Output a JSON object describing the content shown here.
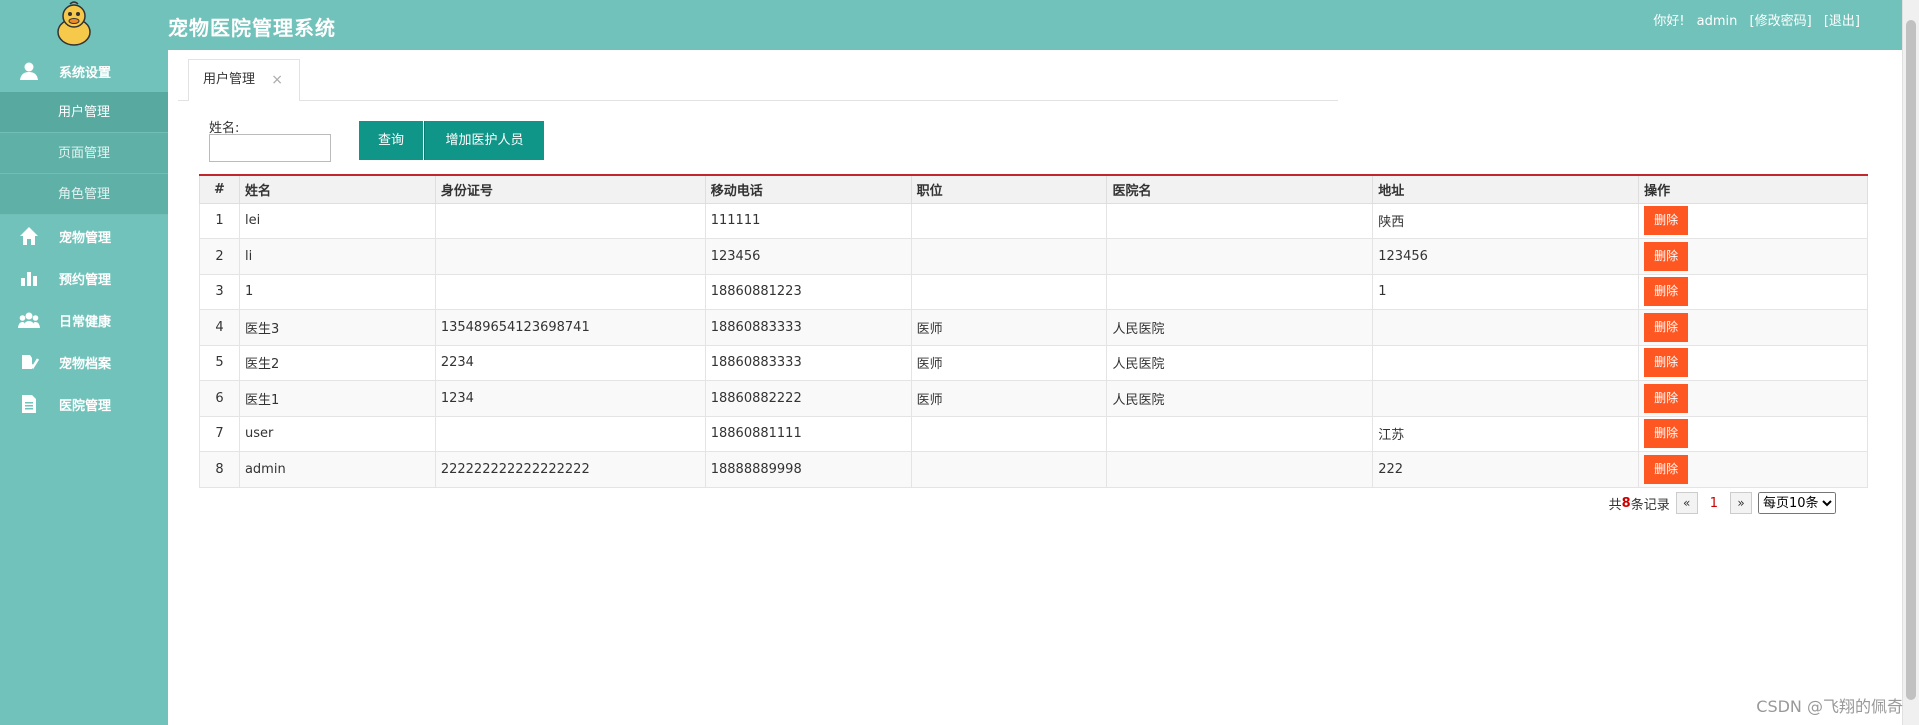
{
  "header": {
    "title": "宠物医院管理系统",
    "greeting": "你好!",
    "username": "admin",
    "change_password": "[修改密码]",
    "logout": "[退出]"
  },
  "sidebar": {
    "items": [
      {
        "label": "系统设置",
        "icon": "user-icon"
      },
      {
        "label": "宠物管理",
        "icon": "home-icon"
      },
      {
        "label": "预约管理",
        "icon": "bar-chart-icon"
      },
      {
        "label": "日常健康",
        "icon": "users-icon"
      },
      {
        "label": "宠物档案",
        "icon": "pet-file-icon"
      },
      {
        "label": "医院管理",
        "icon": "document-icon"
      }
    ],
    "submenu": [
      "用户管理",
      "页面管理",
      "角色管理"
    ]
  },
  "tabs": [
    {
      "label": "用户管理",
      "close": "×"
    }
  ],
  "search": {
    "label": "姓名:",
    "value": "",
    "placeholder": "",
    "query_button": "查询",
    "add_button": "增加医护人员"
  },
  "table": {
    "columns": [
      "#",
      "姓名",
      "身份证号",
      "移动电话",
      "职位",
      "医院名",
      "地址",
      "操作"
    ],
    "rows": [
      [
        "1",
        "lei",
        "",
        "111111",
        "",
        "",
        "陕西"
      ],
      [
        "2",
        "li",
        "",
        "123456",
        "",
        "",
        "123456"
      ],
      [
        "3",
        "1",
        "",
        "18860881223",
        "",
        "",
        "1"
      ],
      [
        "4",
        "医生3",
        "135489654123698741",
        "18860883333",
        "医师",
        "人民医院",
        ""
      ],
      [
        "5",
        "医生2",
        "2234",
        "18860883333",
        "医师",
        "人民医院",
        ""
      ],
      [
        "6",
        "医生1",
        "1234",
        "18860882222",
        "医师",
        "人民医院",
        ""
      ],
      [
        "7",
        "user",
        "",
        "18860881111",
        "",
        "",
        "江苏"
      ],
      [
        "8",
        "admin",
        "222222222222222222",
        "18888889998",
        "",
        "",
        "222"
      ]
    ],
    "delete_label": "删除"
  },
  "pager": {
    "total_prefix": "共",
    "total": "8",
    "total_suffix": "条记录",
    "prev": "«",
    "current": "1",
    "next": "»",
    "page_size": "每页10条"
  },
  "watermark": "CSDN @飞翔的佩奇",
  "colors": {
    "primary": "#71c2ba",
    "button": "#109688",
    "danger": "#ff5722",
    "table_top_border": "#c0282d"
  }
}
